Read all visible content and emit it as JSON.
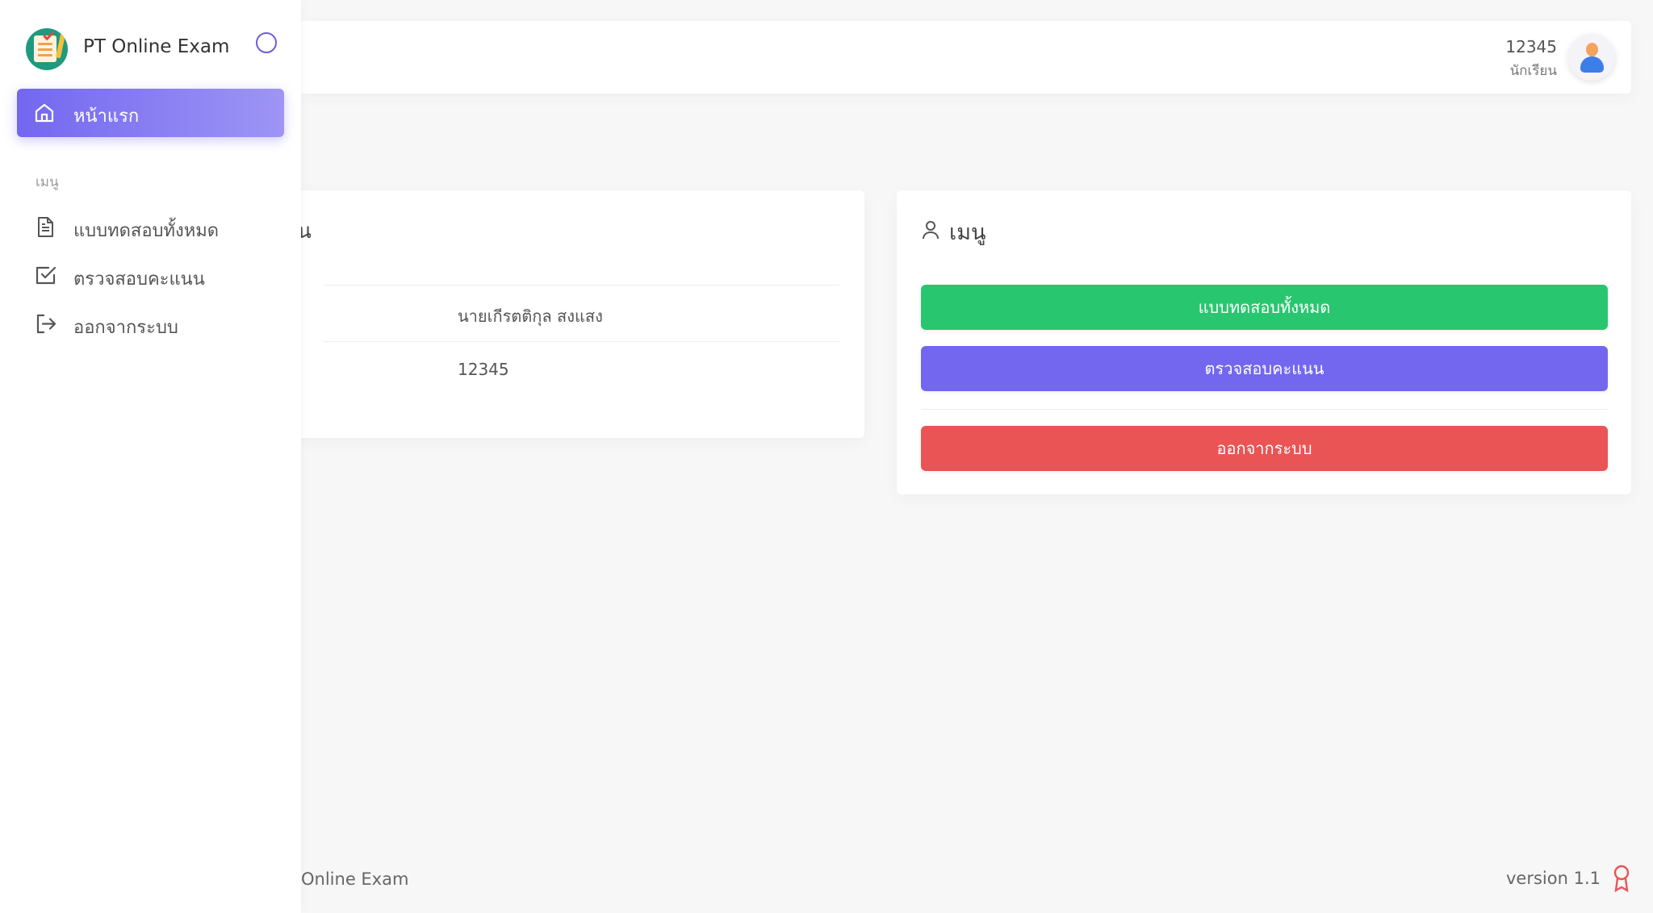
{
  "app": {
    "title": "PT Online Exam",
    "footer_text": "Online Exam",
    "version": "version 1.1"
  },
  "colors": {
    "primary": "#7367f0",
    "success": "#28c76f",
    "danger": "#ea5455"
  },
  "sidebar": {
    "home_label": "หน้าแรก",
    "section_label": "เมนู",
    "items": [
      {
        "label": "แบบทดสอบทั้งหมด",
        "icon": "document-icon"
      },
      {
        "label": "ตรวจสอบคะแนน",
        "icon": "check-square-icon"
      },
      {
        "label": "ออกจากระบบ",
        "icon": "logout-icon"
      }
    ]
  },
  "navbar": {
    "user_id": "12345",
    "user_role": "นักเรียน"
  },
  "profile_card": {
    "title_fragment": "น",
    "rows": [
      {
        "value": "นายเกีรตติกุล สงแสง"
      },
      {
        "value": "12345"
      }
    ]
  },
  "menu_card": {
    "title": "เมนู",
    "buttons": [
      {
        "label": "แบบทดสอบทั้งหมด"
      },
      {
        "label": "ตรวจสอบคะแนน"
      },
      {
        "label": "ออกจากระบบ"
      }
    ]
  }
}
